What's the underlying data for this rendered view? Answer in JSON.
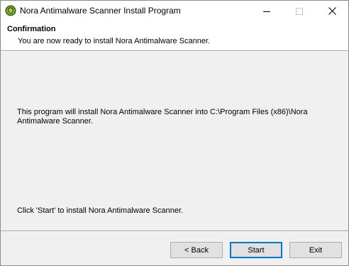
{
  "window": {
    "title": "Nora Antimalware Scanner Install Program",
    "icon": "green-shield-icon",
    "controls": {
      "minimize": "minimize-icon",
      "maximize": "maximize-icon",
      "close": "close-icon"
    }
  },
  "header": {
    "title": "Confirmation",
    "subtitle": "You are now ready to install Nora Antimalware Scanner."
  },
  "body": {
    "description": "This program will install Nora Antimalware Scanner into C:\\Program Files (x86)\\Nora Antimalware Scanner.",
    "hint": "Click 'Start' to install Nora Antimalware Scanner."
  },
  "buttons": {
    "back": "< Back",
    "start": "Start",
    "exit": "Exit"
  },
  "colors": {
    "accent": "#0078d7",
    "panel": "#f0f0f0",
    "header_bg": "#ffffff"
  }
}
